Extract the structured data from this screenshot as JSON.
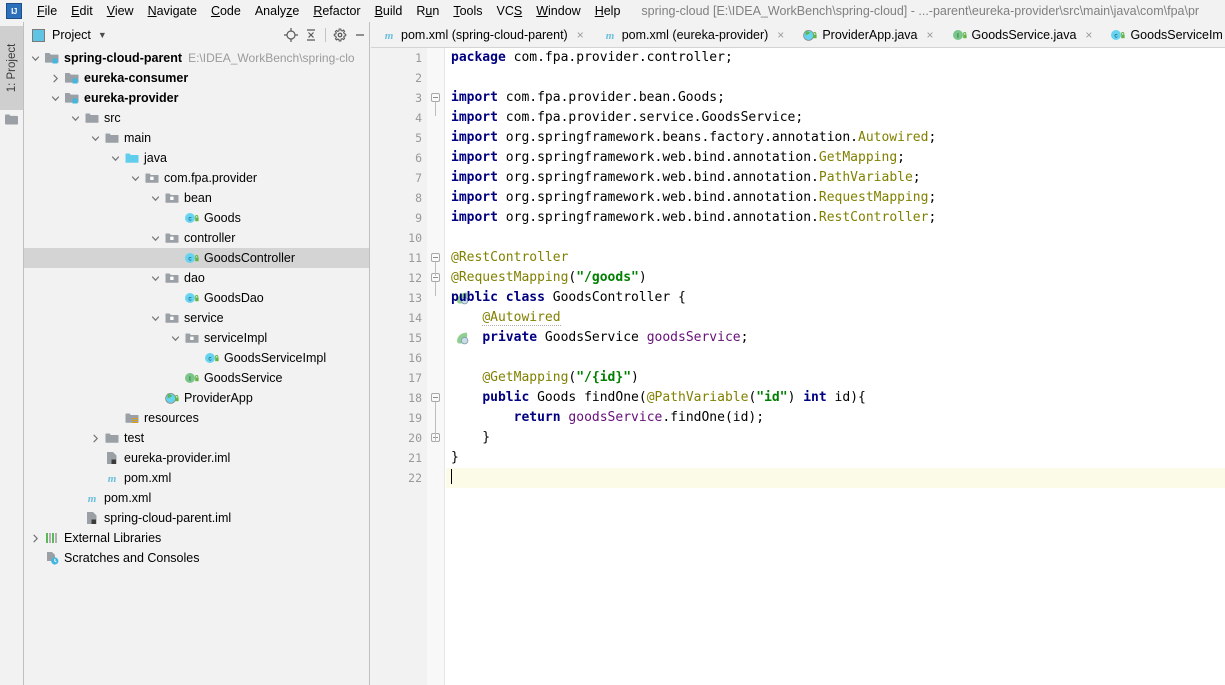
{
  "window": {
    "logo": "IJ",
    "title": "spring-cloud [E:\\IDEA_WorkBench\\spring-cloud] - ...-parent\\eureka-provider\\src\\main\\java\\com\\fpa\\pr"
  },
  "menu": [
    {
      "label": "File",
      "mnemonic": "F"
    },
    {
      "label": "Edit",
      "mnemonic": "E"
    },
    {
      "label": "View",
      "mnemonic": "V"
    },
    {
      "label": "Navigate",
      "mnemonic": "N"
    },
    {
      "label": "Code",
      "mnemonic": "C"
    },
    {
      "label": "Analyze",
      "mnemonic": "z"
    },
    {
      "label": "Refactor",
      "mnemonic": "R"
    },
    {
      "label": "Build",
      "mnemonic": "B"
    },
    {
      "label": "Run",
      "mnemonic": "u"
    },
    {
      "label": "Tools",
      "mnemonic": "T"
    },
    {
      "label": "VCS",
      "mnemonic": "S"
    },
    {
      "label": "Window",
      "mnemonic": "W"
    },
    {
      "label": "Help",
      "mnemonic": "H"
    }
  ],
  "toolstrip": {
    "project_tab": "1: Project"
  },
  "project_panel": {
    "title": "Project",
    "toolbar": [
      "locate-icon",
      "collapse-all-icon",
      "settings-gear-icon",
      "hide-icon"
    ],
    "tree": [
      {
        "depth": 0,
        "arrow": "down",
        "icon": "module-folder",
        "label": "spring-cloud-parent",
        "bold": true,
        "path": "E:\\IDEA_WorkBench\\spring-clo"
      },
      {
        "depth": 1,
        "arrow": "right",
        "icon": "module-folder",
        "label": "eureka-consumer",
        "bold": true,
        "path": ""
      },
      {
        "depth": 1,
        "arrow": "down",
        "icon": "module-folder",
        "label": "eureka-provider",
        "bold": true,
        "path": ""
      },
      {
        "depth": 2,
        "arrow": "down",
        "icon": "folder-gray",
        "label": "src",
        "bold": false,
        "path": ""
      },
      {
        "depth": 3,
        "arrow": "down",
        "icon": "folder-gray",
        "label": "main",
        "bold": false,
        "path": ""
      },
      {
        "depth": 4,
        "arrow": "down",
        "icon": "folder-source",
        "label": "java",
        "bold": false,
        "path": ""
      },
      {
        "depth": 5,
        "arrow": "down",
        "icon": "package",
        "label": "com.fpa.provider",
        "bold": false,
        "path": ""
      },
      {
        "depth": 6,
        "arrow": "down",
        "icon": "package",
        "label": "bean",
        "bold": false,
        "path": ""
      },
      {
        "depth": 7,
        "arrow": "none",
        "icon": "java-class",
        "label": "Goods",
        "bold": false,
        "path": ""
      },
      {
        "depth": 6,
        "arrow": "down",
        "icon": "package",
        "label": "controller",
        "bold": false,
        "path": ""
      },
      {
        "depth": 7,
        "arrow": "none",
        "icon": "java-class",
        "label": "GoodsController",
        "bold": false,
        "path": "",
        "selected": true
      },
      {
        "depth": 6,
        "arrow": "down",
        "icon": "package",
        "label": "dao",
        "bold": false,
        "path": ""
      },
      {
        "depth": 7,
        "arrow": "none",
        "icon": "java-class",
        "label": "GoodsDao",
        "bold": false,
        "path": ""
      },
      {
        "depth": 6,
        "arrow": "down",
        "icon": "package",
        "label": "service",
        "bold": false,
        "path": ""
      },
      {
        "depth": 7,
        "arrow": "down",
        "icon": "package",
        "label": "serviceImpl",
        "bold": false,
        "path": ""
      },
      {
        "depth": 8,
        "arrow": "none",
        "icon": "java-class",
        "label": "GoodsServiceImpl",
        "bold": false,
        "path": ""
      },
      {
        "depth": 7,
        "arrow": "none",
        "icon": "java-interface",
        "label": "GoodsService",
        "bold": false,
        "path": ""
      },
      {
        "depth": 6,
        "arrow": "none",
        "icon": "spring-boot-class",
        "label": "ProviderApp",
        "bold": false,
        "path": ""
      },
      {
        "depth": 4,
        "arrow": "none",
        "icon": "folder-resources",
        "label": "resources",
        "bold": false,
        "path": ""
      },
      {
        "depth": 3,
        "arrow": "right",
        "icon": "folder-gray",
        "label": "test",
        "bold": false,
        "path": ""
      },
      {
        "depth": 3,
        "arrow": "none",
        "icon": "iml-file",
        "label": "eureka-provider.iml",
        "bold": false,
        "path": ""
      },
      {
        "depth": 3,
        "arrow": "none",
        "icon": "maven-file",
        "label": "pom.xml",
        "bold": false,
        "path": ""
      },
      {
        "depth": 2,
        "arrow": "none",
        "icon": "maven-file",
        "label": "pom.xml",
        "bold": false,
        "path": ""
      },
      {
        "depth": 2,
        "arrow": "none",
        "icon": "iml-file",
        "label": "spring-cloud-parent.iml",
        "bold": false,
        "path": ""
      },
      {
        "depth": 0,
        "arrow": "right",
        "icon": "libraries",
        "label": "External Libraries",
        "bold": false,
        "path": ""
      },
      {
        "depth": 0,
        "arrow": "none",
        "icon": "scratches",
        "label": "Scratches and Consoles",
        "bold": false,
        "path": ""
      }
    ]
  },
  "editor": {
    "tabs": [
      {
        "label": "pom.xml (spring-cloud-parent)",
        "icon": "maven-file",
        "active": false,
        "closable": true
      },
      {
        "label": "pom.xml (eureka-provider)",
        "icon": "maven-file",
        "active": false,
        "closable": true
      },
      {
        "label": "ProviderApp.java",
        "icon": "spring-boot-class",
        "active": false,
        "closable": true
      },
      {
        "label": "GoodsService.java",
        "icon": "java-interface",
        "active": false,
        "closable": true
      },
      {
        "label": "GoodsServiceIm",
        "icon": "java-class",
        "active": false,
        "closable": false
      }
    ],
    "line_numbers": [
      1,
      2,
      3,
      4,
      5,
      6,
      7,
      8,
      9,
      10,
      11,
      12,
      13,
      14,
      15,
      16,
      17,
      18,
      19,
      20,
      21,
      22
    ],
    "caret_line": 22,
    "gutter_icons": [
      {
        "line": 13,
        "name": "spring-bean-gutter-icon"
      },
      {
        "line": 15,
        "name": "spring-autowired-gutter-icon"
      }
    ],
    "fold_markers": [
      3,
      11,
      12,
      18,
      20
    ],
    "lines": [
      {
        "n": 1,
        "tokens": [
          {
            "t": "package",
            "c": "kw"
          },
          {
            "t": " com.fpa.provider.controller;",
            "c": ""
          }
        ]
      },
      {
        "n": 2,
        "tokens": []
      },
      {
        "n": 3,
        "tokens": [
          {
            "t": "import",
            "c": "kw"
          },
          {
            "t": " com.fpa.provider.bean.Goods;",
            "c": ""
          }
        ]
      },
      {
        "n": 4,
        "tokens": [
          {
            "t": "import",
            "c": "kw"
          },
          {
            "t": " com.fpa.provider.service.GoodsService;",
            "c": ""
          }
        ]
      },
      {
        "n": 5,
        "tokens": [
          {
            "t": "import",
            "c": "kw"
          },
          {
            "t": " org.springframework.beans.factory.annotation.",
            "c": ""
          },
          {
            "t": "Autowired",
            "c": "ann"
          },
          {
            "t": ";",
            "c": ""
          }
        ]
      },
      {
        "n": 6,
        "tokens": [
          {
            "t": "import",
            "c": "kw"
          },
          {
            "t": " org.springframework.web.bind.annotation.",
            "c": ""
          },
          {
            "t": "GetMapping",
            "c": "ann"
          },
          {
            "t": ";",
            "c": ""
          }
        ]
      },
      {
        "n": 7,
        "tokens": [
          {
            "t": "import",
            "c": "kw"
          },
          {
            "t": " org.springframework.web.bind.annotation.",
            "c": ""
          },
          {
            "t": "PathVariable",
            "c": "ann"
          },
          {
            "t": ";",
            "c": ""
          }
        ]
      },
      {
        "n": 8,
        "tokens": [
          {
            "t": "import",
            "c": "kw"
          },
          {
            "t": " org.springframework.web.bind.annotation.",
            "c": ""
          },
          {
            "t": "RequestMapping",
            "c": "ann"
          },
          {
            "t": ";",
            "c": ""
          }
        ]
      },
      {
        "n": 9,
        "tokens": [
          {
            "t": "import",
            "c": "kw"
          },
          {
            "t": " org.springframework.web.bind.annotation.",
            "c": ""
          },
          {
            "t": "RestController",
            "c": "ann"
          },
          {
            "t": ";",
            "c": ""
          }
        ]
      },
      {
        "n": 10,
        "tokens": []
      },
      {
        "n": 11,
        "tokens": [
          {
            "t": "@RestController",
            "c": "ann"
          }
        ]
      },
      {
        "n": 12,
        "tokens": [
          {
            "t": "@RequestMapping",
            "c": "ann"
          },
          {
            "t": "(",
            "c": ""
          },
          {
            "t": "\"/goods\"",
            "c": "str"
          },
          {
            "t": ")",
            "c": ""
          }
        ]
      },
      {
        "n": 13,
        "tokens": [
          {
            "t": "public",
            "c": "kw"
          },
          {
            "t": " ",
            "c": ""
          },
          {
            "t": "class",
            "c": "kw"
          },
          {
            "t": " GoodsController {",
            "c": ""
          }
        ]
      },
      {
        "n": 14,
        "tokens": [
          {
            "t": "    ",
            "c": ""
          },
          {
            "t": "@Autowired",
            "c": "ann err-underline"
          }
        ]
      },
      {
        "n": 15,
        "tokens": [
          {
            "t": "    ",
            "c": ""
          },
          {
            "t": "private",
            "c": "kw"
          },
          {
            "t": " GoodsService ",
            "c": ""
          },
          {
            "t": "goodsService",
            "c": "fld"
          },
          {
            "t": ";",
            "c": ""
          }
        ]
      },
      {
        "n": 16,
        "tokens": []
      },
      {
        "n": 17,
        "tokens": [
          {
            "t": "    ",
            "c": ""
          },
          {
            "t": "@GetMapping",
            "c": "ann"
          },
          {
            "t": "(",
            "c": ""
          },
          {
            "t": "\"/{id}\"",
            "c": "str"
          },
          {
            "t": ")",
            "c": ""
          }
        ]
      },
      {
        "n": 18,
        "tokens": [
          {
            "t": "    ",
            "c": ""
          },
          {
            "t": "public",
            "c": "kw"
          },
          {
            "t": " Goods findOne(",
            "c": ""
          },
          {
            "t": "@PathVariable",
            "c": "ann"
          },
          {
            "t": "(",
            "c": ""
          },
          {
            "t": "\"id\"",
            "c": "str"
          },
          {
            "t": ") ",
            "c": ""
          },
          {
            "t": "int",
            "c": "kw"
          },
          {
            "t": " id){",
            "c": ""
          }
        ]
      },
      {
        "n": 19,
        "tokens": [
          {
            "t": "        ",
            "c": ""
          },
          {
            "t": "return",
            "c": "kw"
          },
          {
            "t": " ",
            "c": ""
          },
          {
            "t": "goodsService",
            "c": "fld"
          },
          {
            "t": ".findOne(id);",
            "c": ""
          }
        ]
      },
      {
        "n": 20,
        "tokens": [
          {
            "t": "    }",
            "c": ""
          }
        ]
      },
      {
        "n": 21,
        "tokens": [
          {
            "t": "}",
            "c": ""
          }
        ]
      },
      {
        "n": 22,
        "tokens": []
      }
    ]
  },
  "colors": {
    "keyword": "#000080",
    "annotation": "#808000",
    "string": "#008000",
    "field": "#660e7a",
    "selection": "#d4d4d4",
    "caret_line": "#fcfbe8",
    "panel_bg": "#f2f2f2",
    "editor_bg": "#ffffff"
  }
}
